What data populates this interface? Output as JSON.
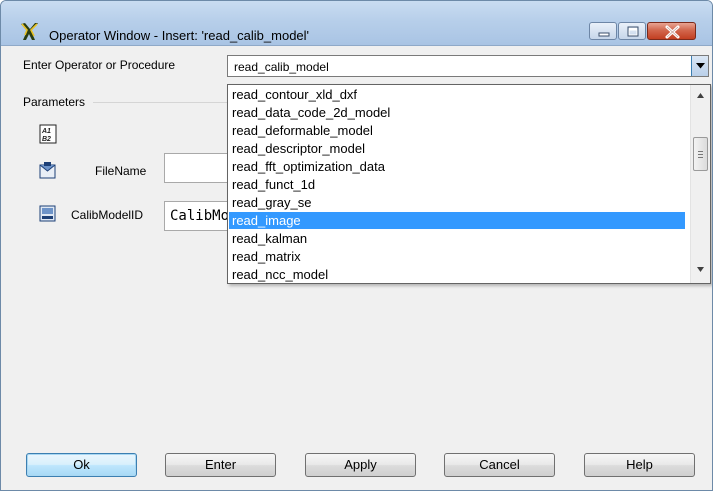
{
  "window": {
    "title": "Operator Window - Insert: 'read_calib_model'"
  },
  "operator_selector": {
    "label": "Enter Operator or Procedure",
    "value": "read_calib_model",
    "dropdown_items": [
      "read_contour_xld_dxf",
      "read_data_code_2d_model",
      "read_deformable_model",
      "read_descriptor_model",
      "read_fft_optimization_data",
      "read_funct_1d",
      "read_gray_se",
      "read_image",
      "read_kalman",
      "read_matrix",
      "read_ncc_model"
    ],
    "selected_item": "read_image"
  },
  "parameters": {
    "section_label": "Parameters",
    "filename_label": "FileName",
    "filename_value": "",
    "calib_label": "CalibModelID",
    "calib_value": "CalibModelID"
  },
  "buttons": {
    "ok": "Ok",
    "enter": "Enter",
    "apply": "Apply",
    "cancel": "Cancel",
    "help": "Help"
  },
  "colors": {
    "selection": "#3399ff",
    "close_button": "#c23f22",
    "titlebar": "#b7cfea"
  }
}
